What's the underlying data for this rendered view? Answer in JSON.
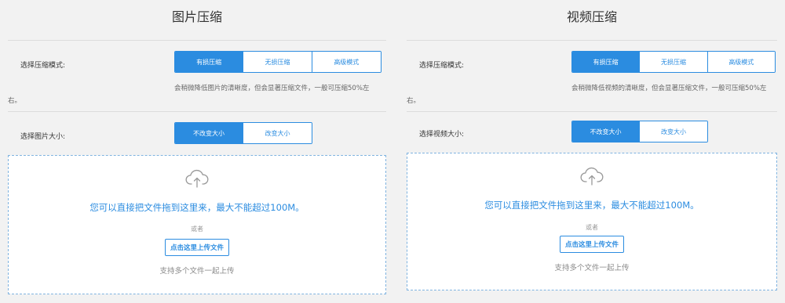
{
  "image_panel": {
    "title": "图片压缩",
    "mode_label": "选择压缩模式:",
    "modes": [
      {
        "label": "有损压缩",
        "active": true
      },
      {
        "label": "无损压缩",
        "active": false
      },
      {
        "label": "高级模式",
        "active": false
      }
    ],
    "desc_line1": "会稍微降低图片的清晰度，但会显著压缩文件，一般可压缩50%左",
    "desc_line2": "右。",
    "size_label": "选择图片大小:",
    "sizes": [
      {
        "label": "不改变大小",
        "active": true
      },
      {
        "label": "改变大小",
        "active": false
      }
    ],
    "drop_text": "您可以直接把文件拖到这里来，最大不能超过100M。",
    "or_text": "或者",
    "upload_button": "点击这里上传文件",
    "multi_text": "支持多个文件一起上传"
  },
  "video_panel": {
    "title": "视频压缩",
    "mode_label": "选择压缩模式:",
    "modes": [
      {
        "label": "有损压缩",
        "active": true
      },
      {
        "label": "无损压缩",
        "active": false
      },
      {
        "label": "高级模式",
        "active": false
      }
    ],
    "desc_line1": "会稍微降低视频的清晰度，但会显著压缩文件，一般可压缩50%左",
    "desc_line2": "右。",
    "size_label": "选择视频大小:",
    "sizes": [
      {
        "label": "不改变大小",
        "active": true
      },
      {
        "label": "改变大小",
        "active": false
      }
    ],
    "drop_text": "您可以直接把文件拖到这里来，最大不能超过100M。",
    "or_text": "或者",
    "upload_button": "点击这里上传文件",
    "multi_text": "支持多个文件一起上传"
  },
  "colors": {
    "accent": "#2b8ce0",
    "page_bg": "#f2f2f2",
    "dropzone_border": "#7fb3e0"
  },
  "icons": {
    "upload": "cloud-upload-icon"
  }
}
